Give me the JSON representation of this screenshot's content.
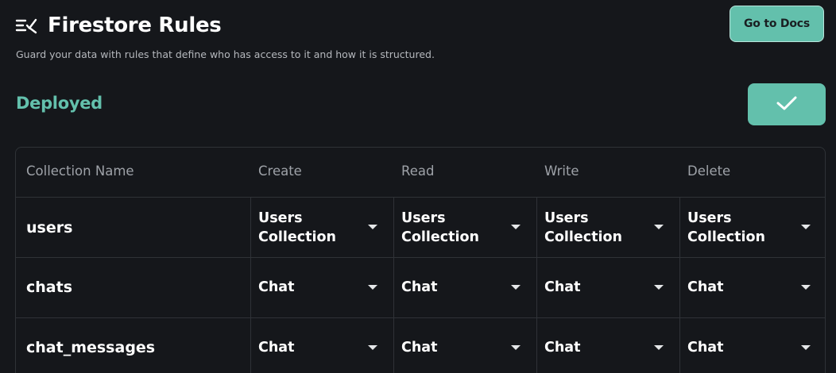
{
  "header": {
    "title": "Firestore Rules",
    "subtitle": "Guard your data with rules that define who has access to it and how it is structured.",
    "docs_button_label": "Go to Docs",
    "title_icon": "rules-list-icon"
  },
  "status": {
    "label": "Deployed",
    "deploy_button_icon": "checkmark-icon"
  },
  "colors": {
    "accent": "#63c0ac",
    "background": "#15171b",
    "border": "#2f3237"
  },
  "table": {
    "headers": [
      "Collection Name",
      "Create",
      "Read",
      "Write",
      "Delete"
    ],
    "rows": [
      {
        "collection": "users",
        "create": "Users Collection",
        "read": "Users Collection",
        "write": "Users Collection",
        "delete": "Users Collection"
      },
      {
        "collection": "chats",
        "create": "Chat",
        "read": "Chat",
        "write": "Chat",
        "delete": "Chat"
      },
      {
        "collection": "chat_messages",
        "create": "Chat",
        "read": "Chat",
        "write": "Chat",
        "delete": "Chat"
      }
    ]
  }
}
